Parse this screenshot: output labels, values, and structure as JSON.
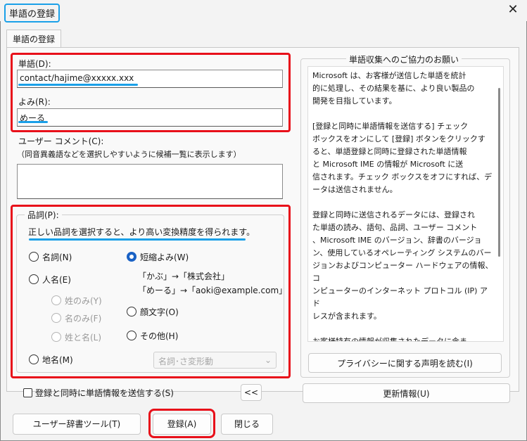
{
  "window": {
    "title": "単語の登録",
    "close_glyph": "✕"
  },
  "tab": {
    "label": "単語の登録"
  },
  "word": {
    "label": "単語(D):",
    "value": "contact/hajime@xxxxx.xxx"
  },
  "reading": {
    "label": "よみ(R):",
    "value": "めーる"
  },
  "comment": {
    "label": "ユーザー コメント(C):",
    "hint": "（同音異義語などを選択しやすいように候補一覧に表示します）",
    "value": ""
  },
  "pos": {
    "title": "品詞(P):",
    "description": "正しい品詞を選択すると、より高い変換精度を得られます。",
    "options": {
      "noun": "名詞(N)",
      "person": "人名(E)",
      "surname": "姓のみ(Y)",
      "given": "名のみ(F)",
      "both": "姓と名(L)",
      "place": "地名(M)",
      "short": "短縮よみ(W)",
      "emoticon": "顔文字(O)",
      "other": "その他(H)"
    },
    "selected": "short",
    "example1": "「かぶ」→「株式会社」",
    "example2": "「めーる」→「aoki@example.com」",
    "dropdown_value": "名詞･さ変形動"
  },
  "send_checkbox": {
    "label": "登録と同時に単語情報を送信する(S)",
    "checked": false
  },
  "collapse_button": "<<",
  "info": {
    "title": "単語収集へのご協力のお願い",
    "text": "Microsoft は、お客様が送信した単語を統計\n的に処理し、その結果を基に、より良い製品の\n開発を目指しています。\n\n[登録と同時に単語情報を送信する] チェック\nボックスをオンにして [登録] ボタンをクリックす\nると、単語登録と同時に登録された単語情報\nと Microsoft IME の情報が Microsoft に送\n信されます。チェック ボックスをオフにすれば、デ\nータは送信されません。\n\n登録と同時に送信されるデータには、登録され\nた単語の読み、語句、品詞、ユーザー コメント\n、Microsoft IME のバージョン、辞書のバージョ\nン、使用しているオペレーティング システムのバー\nジョンおよびコンピューター ハードウェアの情報、コ\nンピューターのインターネット プロトコル (IP) アド\nレスが含まれます。\n\nお客様特有の情報が収集されたデータに含ま\nれることがあります。このような情報が存在する\n場合でも、Microsoft では、お客様を特定す\nるために使用することはありません。",
    "privacy_button": "プライバシーに関する声明を読む(I)",
    "update_button": "更新情報(U)"
  },
  "footer": {
    "dict_tool_button": "ユーザー辞書ツール(T)",
    "register_button": "登録(A)",
    "close_button": "閉じる"
  },
  "colors": {
    "highlight_red": "#e8101a",
    "highlight_blue": "#1aa0e8",
    "radio_selected": "#1a62c5"
  }
}
